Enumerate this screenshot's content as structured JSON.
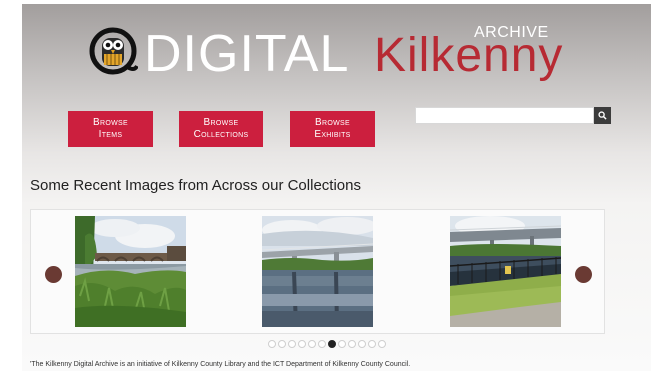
{
  "logo": {
    "digital": "DIGITAL",
    "kilkenny": "Kilkenny",
    "archive": "ARCHIVE",
    "brand_red": "#b72a33"
  },
  "nav": {
    "items": [
      "Browse Items"
    ],
    "collections": [
      "Browse Collections"
    ],
    "exhibits": [
      "Browse Exhibits"
    ],
    "items_label_1": "Browse",
    "items_label_2": "Items",
    "collections_label_1": "Browse",
    "collections_label_2": "Collections",
    "exhibits_label_1": "Browse",
    "exhibits_label_2": "Exhibits",
    "button_color": "#cc1f3e"
  },
  "search": {
    "value": "",
    "icon": "search-icon"
  },
  "section": {
    "heading": "Some Recent Images from Across our Collections"
  },
  "carousel": {
    "prev_icon": "circle-arrow-left-icon",
    "next_icon": "circle-arrow-right-icon",
    "images": [
      {
        "subject": "river with stone bridge and greenery"
      },
      {
        "subject": "modern bridge over river"
      },
      {
        "subject": "bridge and riverside path with railing"
      }
    ],
    "dot_count": 12,
    "active_dot": 7
  },
  "footer": {
    "text": "'The Kilkenny Digital Archive is an initiative of Kilkenny County Library and the ICT Department of Kilkenny County Council."
  }
}
